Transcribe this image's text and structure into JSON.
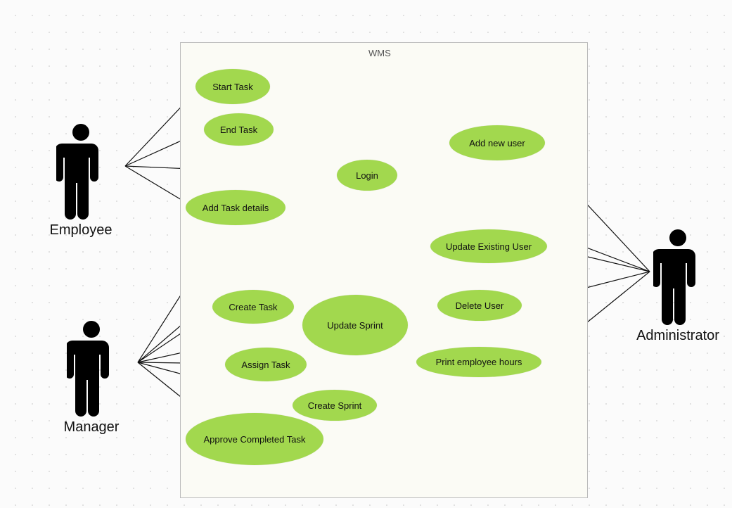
{
  "system": {
    "title": "WMS"
  },
  "actors": {
    "employee": {
      "label": "Employee"
    },
    "manager": {
      "label": "Manager"
    },
    "administrator": {
      "label": "Administrator"
    }
  },
  "usecases": {
    "start_task": {
      "label": "Start Task"
    },
    "end_task": {
      "label": "End Task"
    },
    "login": {
      "label": "Login"
    },
    "add_task_details": {
      "label": "Add Task details"
    },
    "create_task": {
      "label": "Create Task"
    },
    "update_sprint": {
      "label": "Update Sprint"
    },
    "assign_task": {
      "label": "Assign Task"
    },
    "create_sprint": {
      "label": "Create Sprint"
    },
    "approve_completed_task": {
      "label": "Approve Completed Task"
    },
    "add_new_user": {
      "label": "Add new user"
    },
    "update_existing_user": {
      "label": "Update Existing User"
    },
    "delete_user": {
      "label": "Delete User"
    },
    "print_employee_hours": {
      "label": "Print employee hours"
    }
  },
  "chart_data": {
    "type": "uml-use-case",
    "system": "WMS",
    "actors": [
      "Employee",
      "Manager",
      "Administrator"
    ],
    "use_cases": [
      "Start Task",
      "End Task",
      "Login",
      "Add Task details",
      "Create Task",
      "Update Sprint",
      "Assign Task",
      "Create Sprint",
      "Approve Completed Task",
      "Add new user",
      "Update Existing User",
      "Delete User",
      "Print employee hours"
    ],
    "associations": [
      {
        "actor": "Employee",
        "use_case": "Start Task"
      },
      {
        "actor": "Employee",
        "use_case": "End Task"
      },
      {
        "actor": "Employee",
        "use_case": "Login"
      },
      {
        "actor": "Employee",
        "use_case": "Add Task details"
      },
      {
        "actor": "Manager",
        "use_case": "Add Task details"
      },
      {
        "actor": "Manager",
        "use_case": "Login"
      },
      {
        "actor": "Manager",
        "use_case": "Create Task"
      },
      {
        "actor": "Manager",
        "use_case": "Update Sprint"
      },
      {
        "actor": "Manager",
        "use_case": "Assign Task"
      },
      {
        "actor": "Manager",
        "use_case": "Create Sprint"
      },
      {
        "actor": "Manager",
        "use_case": "Approve Completed Task"
      },
      {
        "actor": "Administrator",
        "use_case": "Login"
      },
      {
        "actor": "Administrator",
        "use_case": "Add new user"
      },
      {
        "actor": "Administrator",
        "use_case": "Update Existing User"
      },
      {
        "actor": "Administrator",
        "use_case": "Delete User"
      },
      {
        "actor": "Administrator",
        "use_case": "Print employee hours"
      }
    ]
  }
}
